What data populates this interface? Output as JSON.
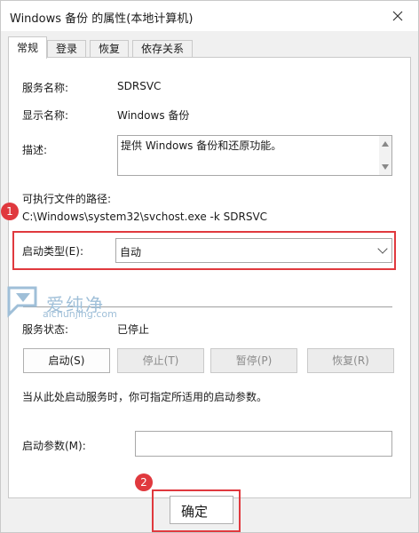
{
  "window": {
    "title": "Windows 备份 的属性(本地计算机)"
  },
  "tabs": [
    {
      "label": "常规"
    },
    {
      "label": "登录"
    },
    {
      "label": "恢复"
    },
    {
      "label": "依存关系"
    }
  ],
  "general": {
    "service_name_label": "服务名称:",
    "service_name_value": "SDRSVC",
    "display_name_label": "显示名称:",
    "display_name_value": "Windows 备份",
    "description_label": "描述:",
    "description_value": "提供 Windows 备份和还原功能。",
    "exec_path_label": "可执行文件的路径:",
    "exec_path_value": "C:\\Windows\\system32\\svchost.exe -k SDRSVC",
    "startup_type_label": "启动类型(E):",
    "startup_type_value": "自动",
    "status_label": "服务状态:",
    "status_value": "已停止",
    "buttons": {
      "start": "启动(S)",
      "stop": "停止(T)",
      "pause": "暂停(P)",
      "resume": "恢复(R)"
    },
    "hint_text": "当从此处启动服务时，你可指定所适用的启动参数。",
    "start_params_label": "启动参数(M):",
    "start_params_value": ""
  },
  "footer": {
    "ok_label": "确定"
  },
  "annotations": {
    "badge1": "1",
    "badge2": "2",
    "color": "#e0393e"
  },
  "watermark": {
    "text_cn": "爱纯净",
    "text_url": "aichunjing.com"
  }
}
